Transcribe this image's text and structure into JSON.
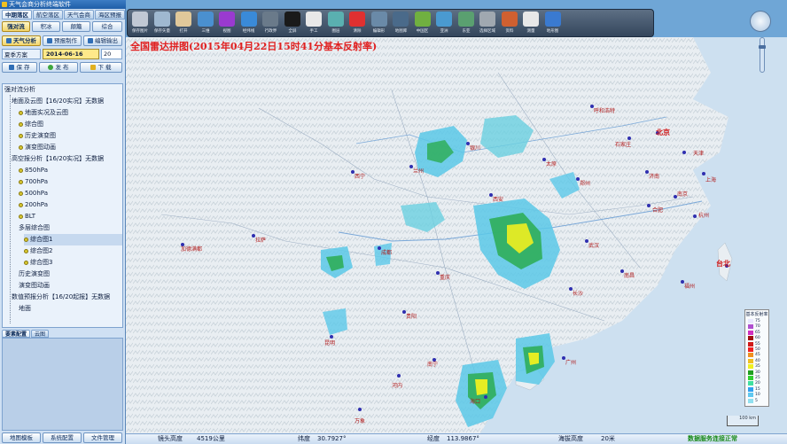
{
  "app": {
    "title": "天气会商分析终端软件"
  },
  "top_tabs": [
    "中期落区",
    "航空落区",
    "天气会商",
    "海区预报"
  ],
  "modes": [
    "强对流",
    "积冰",
    "颠簸",
    "综合"
  ],
  "actions": {
    "weather_analysis": "天气分析",
    "forecast_make": "预报制作",
    "edit_output": "编辑输出"
  },
  "scheme": {
    "label": "夏季方案",
    "date": "2014-06-16",
    "number": "20"
  },
  "file_actions": {
    "save": "保 存",
    "publish": "发 布",
    "download": "下 载"
  },
  "tree": {
    "root": "强对流分析",
    "items": [
      "地面及云图【16/20实况】无数据",
      "地面实况及云图",
      "综合图",
      "历史演变图",
      "演变图动画",
      "高空报分析【16/20实况】无数据",
      "850hPa",
      "700hPa",
      "500hPa",
      "200hPa",
      "BLT",
      "多层综合图",
      "综合图1",
      "综合图2",
      "综合图3",
      "历史演变图",
      "演变图动画",
      "数值预报分析【16/20起报】无数据",
      "地面"
    ]
  },
  "bottom_tabs": [
    "要素配置",
    "云图"
  ],
  "system_buttons": [
    "地图模板",
    "系统配置",
    "文件管理"
  ],
  "toolbar": [
    {
      "label": "保存图片",
      "icon": "save-image-icon",
      "color": "#c0c8d4"
    },
    {
      "label": "保存矢量",
      "icon": "save-vector-icon",
      "color": "#9fb8d0"
    },
    {
      "label": "打开",
      "icon": "open-icon",
      "color": "#e0c89a"
    },
    {
      "label": "三维",
      "icon": "3d-icon",
      "color": "#4a90d0"
    },
    {
      "label": "视图",
      "icon": "view-icon",
      "color": "#9a3ad0"
    },
    {
      "label": "经纬线",
      "icon": "globe-icon",
      "color": "#3a8ad8"
    },
    {
      "label": "行政界",
      "icon": "location-icon",
      "color": "#6a7a8a"
    },
    {
      "label": "全屏",
      "icon": "monitor-icon",
      "color": "#1a1a1a"
    },
    {
      "label": "手工",
      "icon": "hand-icon",
      "color": "#e8e8e8"
    },
    {
      "label": "图层",
      "icon": "layers-icon",
      "color": "#5ab0b0"
    },
    {
      "label": "清除",
      "icon": "clear-icon",
      "color": "#e03030"
    },
    {
      "label": "编辑形",
      "icon": "edit-shape-icon",
      "color": "#6a8aa8"
    },
    {
      "label": "地图库",
      "icon": "map-library-icon",
      "color": "#4a6a8a"
    },
    {
      "label": "中国区",
      "icon": "china-map-icon",
      "color": "#70b040"
    },
    {
      "label": "亚洲",
      "icon": "asia-map-icon",
      "color": "#4a9ad0"
    },
    {
      "label": "东亚",
      "icon": "east-asia-map-icon",
      "color": "#5aa070"
    },
    {
      "label": "选择区域",
      "icon": "select-area-icon",
      "color": "#a0a8b0"
    },
    {
      "label": "资料",
      "icon": "data-icon",
      "color": "#d06030"
    },
    {
      "label": "测量",
      "icon": "measure-icon",
      "color": "#e8e8e8"
    },
    {
      "label": "地形图",
      "icon": "terrain-icon",
      "color": "#3a7ad0"
    }
  ],
  "map": {
    "title": "全国雷达拼图(2015年04月22日15时41分基本反射率)",
    "cities": [
      {
        "name": "北京"
      },
      {
        "name": "天津"
      },
      {
        "name": "石家庄"
      },
      {
        "name": "济南"
      },
      {
        "name": "合肥"
      },
      {
        "name": "南京"
      },
      {
        "name": "上海"
      },
      {
        "name": "杭州"
      },
      {
        "name": "郑州"
      },
      {
        "name": "武汉"
      },
      {
        "name": "长沙"
      },
      {
        "name": "南昌"
      },
      {
        "name": "福州"
      },
      {
        "name": "台北"
      },
      {
        "name": "广州"
      },
      {
        "name": "南宁"
      },
      {
        "name": "海口"
      },
      {
        "name": "昆明"
      },
      {
        "name": "贵阳"
      },
      {
        "name": "重庆"
      },
      {
        "name": "成都"
      },
      {
        "name": "西安"
      },
      {
        "name": "太原"
      },
      {
        "name": "呼和浩特"
      },
      {
        "name": "银川"
      },
      {
        "name": "兰州"
      },
      {
        "name": "西宁"
      },
      {
        "name": "拉萨"
      },
      {
        "name": "加德满都"
      },
      {
        "name": "万象"
      },
      {
        "name": "河内"
      }
    ]
  },
  "legend": {
    "title": "基本反射率",
    "levels": [
      {
        "value": "75",
        "color": "#e8e8ff"
      },
      {
        "value": "70",
        "color": "#b050d0"
      },
      {
        "value": "65",
        "color": "#d030c0"
      },
      {
        "value": "60",
        "color": "#a01010"
      },
      {
        "value": "55",
        "color": "#d01818"
      },
      {
        "value": "50",
        "color": "#f02020"
      },
      {
        "value": "45",
        "color": "#f09020"
      },
      {
        "value": "40",
        "color": "#f0c020"
      },
      {
        "value": "35",
        "color": "#f0f020"
      },
      {
        "value": "30",
        "color": "#20a020"
      },
      {
        "value": "25",
        "color": "#30d030"
      },
      {
        "value": "20",
        "color": "#40e0a0"
      },
      {
        "value": "15",
        "color": "#30a0f0"
      },
      {
        "value": "10",
        "color": "#60c8f0"
      },
      {
        "value": "5",
        "color": "#90e0f0"
      }
    ],
    "scale": "100 km"
  },
  "status": {
    "altitude_label": "镜头高度",
    "altitude_value": "4519公里",
    "lat_label": "纬度",
    "lat_value": "30.7927°",
    "lon_label": "经度",
    "lon_value": "113.9867°",
    "elev_label": "海拔高度",
    "elev_value": "20米",
    "service": "数据服务连接正常"
  }
}
